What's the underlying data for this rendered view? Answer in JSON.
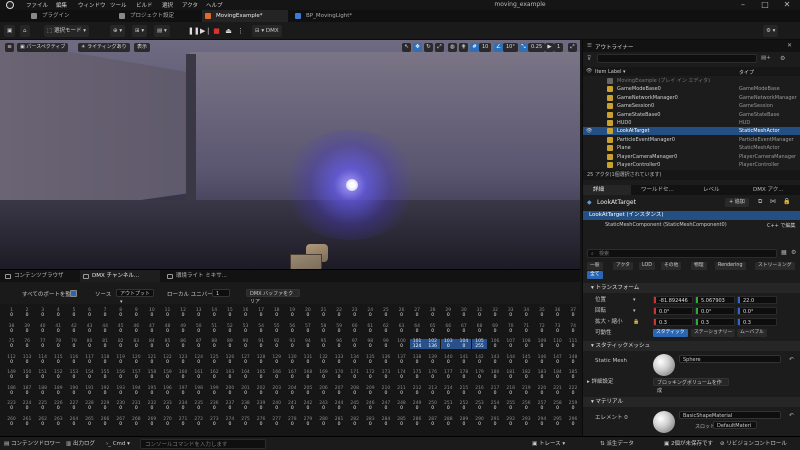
{
  "app": {
    "window_title": "moving_example"
  },
  "menu": [
    "ファイル",
    "編集",
    "ウィンドウ",
    "ツール",
    "ビルド",
    "選択",
    "アクタ",
    "ヘルプ"
  ],
  "tabs": [
    {
      "label": "プラグイン",
      "color": "#888888"
    },
    {
      "label": "プロジェクト設定",
      "color": "#888888"
    },
    {
      "label": "MovingExample*",
      "color": "#e26a2c"
    },
    {
      "label": "BP_MovingLight*",
      "color": "#3a7bd5"
    }
  ],
  "toolbar": {
    "mode": "選択モード",
    "platform": "DMX"
  },
  "viewport": {
    "perspective": "パースペクティブ",
    "lighting": "ライティングあり",
    "show": "表示",
    "grid_snap": "10",
    "rot_snap": "10°",
    "scale_snap": "0.25",
    "camera_speed": "1"
  },
  "bottom_tabs": [
    "コンテンツブラウザ",
    "DMX チャンネル...",
    "環境ライト ミキサ..."
  ],
  "dmx": {
    "all_ports_label": "すべてのポートを監視",
    "source_label": "ソース",
    "source_value": "アウトプット",
    "universe_label": "ローカル ユニバース",
    "universe_value": "1",
    "clear_button": "DMX バッファをクリア",
    "rows": [
      {
        "start": 1,
        "values": [
          0,
          0,
          0,
          0,
          0,
          0,
          0,
          0,
          0,
          0,
          0,
          0,
          0,
          0,
          0,
          0,
          0,
          0,
          0,
          0,
          0,
          0,
          0,
          0,
          0,
          0,
          0,
          0,
          0,
          0,
          0,
          0,
          0,
          0,
          0,
          0,
          0
        ],
        "highlight": []
      },
      {
        "start": 38,
        "values": [
          0,
          0,
          0,
          0,
          0,
          0,
          0,
          0,
          0,
          0,
          0,
          0,
          0,
          0,
          0,
          0,
          0,
          0,
          0,
          0,
          0,
          0,
          0,
          0,
          0,
          0,
          0,
          0,
          0,
          0,
          0,
          0,
          0,
          0,
          0,
          0,
          0
        ],
        "highlight": []
      },
      {
        "start": 75,
        "values": [
          0,
          0,
          0,
          0,
          0,
          0,
          0,
          0,
          0,
          0,
          0,
          0,
          0,
          0,
          0,
          0,
          0,
          0,
          0,
          0,
          0,
          0,
          0,
          0,
          0,
          0,
          0,
          0,
          0,
          0,
          0,
          0,
          0,
          0,
          0,
          0,
          0
        ],
        "highlight": []
      },
      {
        "start": 112,
        "values": [
          0,
          0,
          0,
          0,
          0,
          0,
          0,
          0,
          0,
          0,
          0,
          0,
          0,
          0,
          0,
          0,
          0,
          0,
          0,
          0,
          0,
          0,
          0,
          0,
          0,
          0,
          0,
          0,
          0,
          0,
          0,
          0,
          0,
          0,
          0,
          0,
          0
        ],
        "highlight": []
      },
      {
        "start": 149,
        "values": [
          0,
          0,
          0,
          0,
          0,
          0,
          0,
          0,
          0,
          0,
          0,
          0,
          0,
          0,
          0,
          0,
          0,
          0,
          0,
          0,
          0,
          0,
          0,
          0,
          0,
          0,
          0,
          0,
          0,
          0,
          0,
          0,
          0,
          0,
          0,
          0,
          0
        ],
        "highlight": []
      },
      {
        "start": 186,
        "values": [
          0,
          0,
          0,
          0,
          0,
          0,
          0,
          0,
          0,
          0,
          0,
          0,
          0,
          0,
          0,
          0,
          0,
          0,
          0,
          0,
          0,
          0,
          0,
          0,
          0,
          0,
          0,
          0,
          0,
          0,
          0,
          0,
          0,
          0,
          0,
          0,
          0
        ],
        "highlight": []
      },
      {
        "start": 223,
        "values": [
          0,
          0,
          0,
          0,
          0,
          0,
          0,
          0,
          0,
          0,
          0,
          0,
          0,
          0,
          0,
          0,
          0,
          0,
          0,
          0,
          0,
          0,
          0,
          0,
          0,
          0,
          0,
          0,
          0,
          0,
          0,
          0,
          0,
          0,
          0,
          0,
          0
        ],
        "highlight": []
      },
      {
        "start": 260,
        "values": [
          0,
          0,
          0,
          0,
          0,
          0,
          0,
          0,
          0,
          0,
          0,
          0,
          0,
          0,
          0,
          0,
          0,
          0,
          0,
          0,
          0,
          0,
          0,
          0,
          0,
          0,
          0,
          0,
          0,
          0,
          0,
          0,
          0,
          0,
          0,
          0,
          0
        ],
        "highlight": []
      }
    ],
    "top_row_numbers": [
      1,
      2,
      3,
      4,
      5,
      6,
      7,
      8,
      9,
      10,
      11,
      12,
      13,
      14,
      15,
      16,
      17,
      18,
      19,
      20,
      21,
      22,
      23,
      24,
      25,
      26,
      27,
      28,
      29,
      30,
      31,
      32,
      33,
      34,
      35,
      36,
      37
    ],
    "hl_row2": [
      {
        "ch": 101,
        "v": 124
      },
      {
        "ch": 102,
        "v": 136
      },
      {
        "ch": 103,
        "v": 0
      },
      {
        "ch": 104,
        "v": 0
      },
      {
        "ch": 105,
        "v": 255
      }
    ]
  },
  "outliner": {
    "title": "アウトライナー",
    "col_label": "Item Label ▾",
    "col_type": "タイプ",
    "items": [
      {
        "name": "MovingExample (プレイ イン エディタ)",
        "type": "",
        "grey": true,
        "sel": false
      },
      {
        "name": "GameModeBase0",
        "type": "GameModeBase",
        "grey": false,
        "sel": false
      },
      {
        "name": "GameNetworkManager0",
        "type": "GameNetworkManager",
        "grey": false,
        "sel": false
      },
      {
        "name": "GameSession0",
        "type": "GameSession",
        "grey": false,
        "sel": false
      },
      {
        "name": "GameStateBase0",
        "type": "GameStateBase",
        "grey": false,
        "sel": false
      },
      {
        "name": "HUD0",
        "type": "HUD",
        "grey": false,
        "sel": false
      },
      {
        "name": "LookAtTarget",
        "type": "StaticMeshActor",
        "grey": false,
        "sel": true
      },
      {
        "name": "ParticleEventManager0",
        "type": "ParticleEventManager",
        "grey": false,
        "sel": false
      },
      {
        "name": "Plane",
        "type": "StaticMeshActor",
        "grey": false,
        "sel": false
      },
      {
        "name": "PlayerCameraManager0",
        "type": "PlayerCameraManager",
        "grey": false,
        "sel": false
      },
      {
        "name": "PlayerController0",
        "type": "PlayerController",
        "grey": false,
        "sel": false
      }
    ],
    "footer": "25 アクタ(1個選択されています)"
  },
  "details": {
    "tabs": [
      "詳細",
      "ワールドセ...",
      "レベル",
      "DMX アク..."
    ],
    "actor_name": "LookAtTarget",
    "add_button": "+ 追加",
    "instance": "LookAtTarget (インスタンス)",
    "component": "StaticMeshComponent (StaticMeshComponent0)",
    "edit_cpp": "C++ で編集",
    "search_placeholder": "検索",
    "filters": [
      "一般",
      "アクタ",
      "LOD",
      "その他",
      "物理",
      "Rendering",
      "ストリーミング"
    ],
    "all_filter": "全て",
    "transform_title": "トランスフォーム",
    "location_label": "位置",
    "location": [
      "-81.892446",
      "5.067903",
      "22.0"
    ],
    "rotation_label": "回転",
    "rotation": [
      "0.0°",
      "0.0°",
      "0.0°"
    ],
    "scale_label": "拡大・縮小",
    "scale": [
      "0.3",
      "0.3",
      "0.3"
    ],
    "mobility_label": "可動性",
    "mobility": [
      "スタティック",
      "ステーショナリー",
      "ムーバブル"
    ],
    "static_mesh_section": "スタティックメッシュ",
    "static_mesh_label": "Static Mesh",
    "static_mesh_value": "Sphere",
    "advanced_label": "詳細設定",
    "blocking_button": "ブロッキングボリュームを作成",
    "material_section": "マテリアル",
    "element_label": "エレメント 0",
    "material_value": "BasicShapeMaterial",
    "slot_label": "スロット",
    "slot_value": "DefaultMateri"
  },
  "status": {
    "content_drawer": "コンテンツドロワー",
    "output_log": "出力ログ",
    "cmd": "Cmd",
    "console_placeholder": "コンソールコマンドを入力します",
    "trace": "トレース",
    "derived": "派生データ",
    "unsaved": "2個が未保存です",
    "revision": "リビジョンコントロール"
  }
}
